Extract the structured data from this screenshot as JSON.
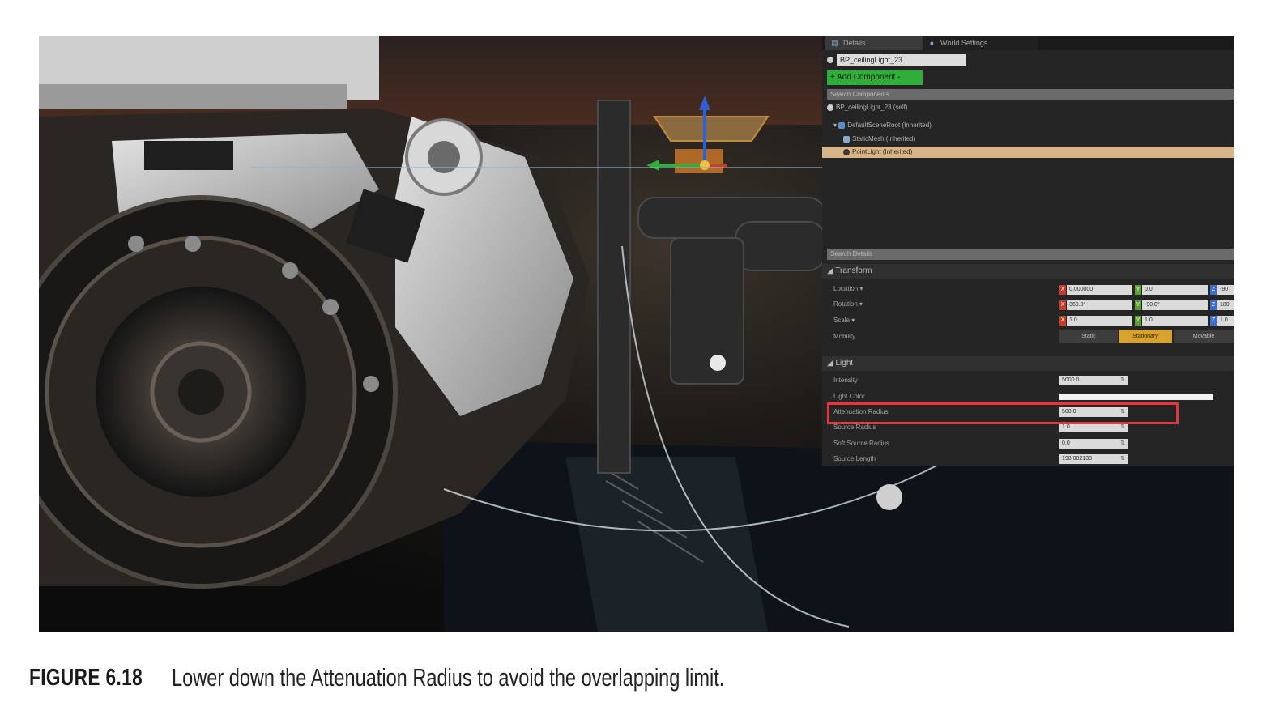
{
  "details_panel": {
    "tabs": [
      {
        "label": "Details",
        "icon": "details-icon"
      },
      {
        "label": "World Settings",
        "icon": "globe-icon"
      }
    ],
    "actor_name": "BP_ceilingLight_23",
    "add_component_label": "+ Add Component -",
    "search_components_placeholder": "Search Components",
    "component_tree": {
      "root": "BP_ceilingLight_23 (self)",
      "scene_root": "DefaultSceneRoot (Inherited)",
      "static_mesh": "StaticMesh (Inherited)",
      "point_light": "PointLight (Inherited)"
    },
    "search_details_placeholder": "Search Details",
    "transform": {
      "title": "Transform",
      "location": {
        "label": "Location ▾",
        "x": "0.000000",
        "y": "0.0",
        "z": "-90"
      },
      "rotation": {
        "label": "Rotation ▾",
        "x": "360.0°",
        "y": "-90.0°",
        "z": "180"
      },
      "scale": {
        "label": "Scale ▾",
        "x": "1.0",
        "y": "1.0",
        "z": "1.0"
      },
      "mobility": {
        "label": "Mobility",
        "options": [
          "Static",
          "Stationary",
          "Movable"
        ],
        "selected": "Stationary"
      }
    },
    "light": {
      "title": "Light",
      "intensity": {
        "label": "Intensity",
        "value": "5000.0"
      },
      "light_color": {
        "label": "Light Color"
      },
      "attenuation_radius": {
        "label": "Attenuation Radius",
        "value": "500.0"
      },
      "source_radius": {
        "label": "Source Radius",
        "value": "1.0"
      },
      "soft_source_radius": {
        "label": "Soft Source Radius",
        "value": "0.0"
      },
      "source_length": {
        "label": "Source Length",
        "value": "198.082138"
      }
    }
  },
  "caption": {
    "label": "FIGURE   6.18",
    "text": "Lower down the Attenuation Radius to avoid the overlapping limit."
  },
  "colors": {
    "highlight": "#e8373c",
    "add_component": "#2fae3a",
    "selected_row": "#d7b588",
    "stationary": "#d8a22c"
  }
}
